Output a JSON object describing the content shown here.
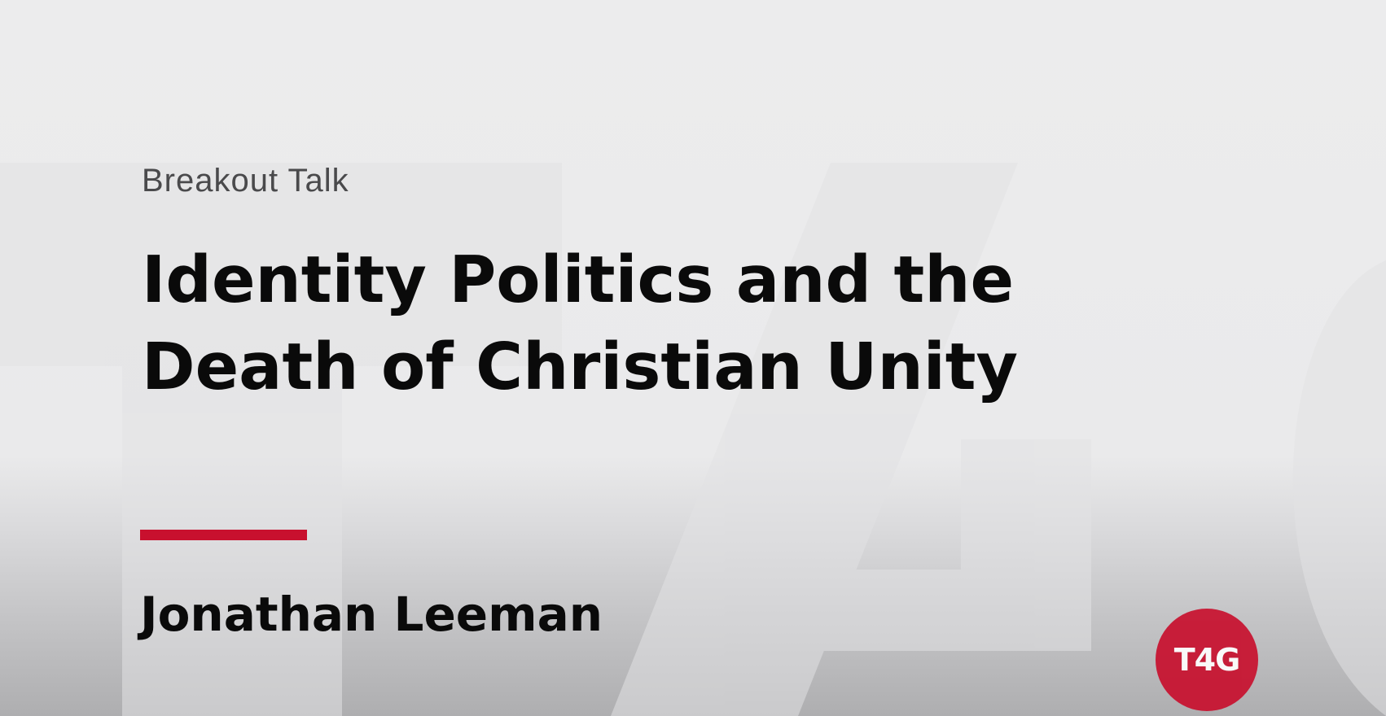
{
  "slide": {
    "kicker": "Breakout Talk",
    "title_lines": [
      "Identity Politics and the",
      "Death of Christian Unity"
    ],
    "speaker": "Jonathan Leeman",
    "logo_text": "T4G"
  },
  "colors": {
    "background": "#ececed",
    "accent": "#c8102e",
    "text_primary": "#0a0a0a",
    "text_secondary": "#4a4a4c",
    "watermark": "#e3e3e5"
  }
}
